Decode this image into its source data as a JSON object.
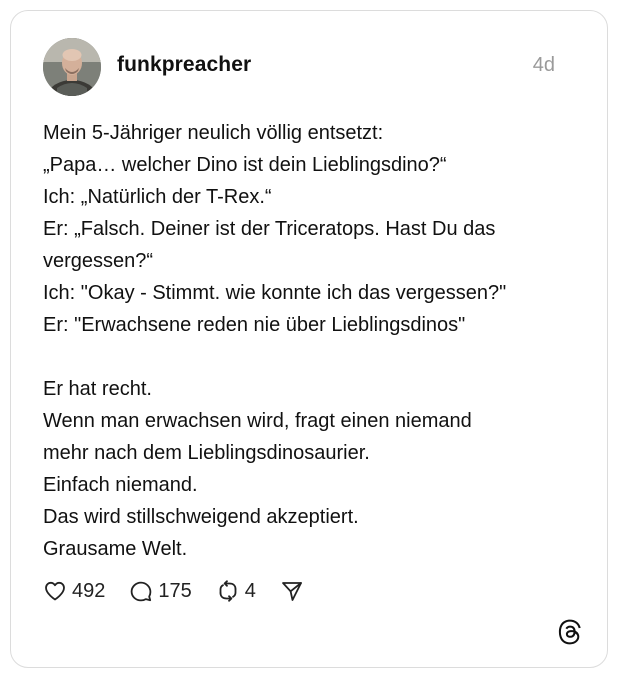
{
  "post": {
    "username": "funkpreacher",
    "time": "4d",
    "lines": [
      "Mein 5-Jähriger neulich völlig entsetzt:",
      "„Papa… welcher Dino ist dein Lieblingsdino?“",
      "Ich: „Natürlich der T-Rex.“",
      "Er: „Falsch. Deiner ist der Triceratops. Hast Du das",
      "vergessen?“",
      "Ich: \"Okay - Stimmt. wie konnte ich das vergessen?\"",
      "Er: \"Erwachsene reden nie über Lieblingsdinos\"",
      "",
      "Er hat recht.",
      "Wenn man erwachsen wird, fragt einen niemand",
      "mehr nach dem Lieblingsdinosaurier.",
      "Einfach niemand.",
      "Das wird stillschweigend akzeptiert.",
      "Grausame Welt."
    ]
  },
  "actions": {
    "likes": "492",
    "comments": "175",
    "reposts": "4"
  },
  "icons": {
    "like": "heart-icon",
    "comment": "comment-bubble-icon",
    "repost": "repost-icon",
    "share": "send-icon",
    "brand": "threads-logo-icon"
  },
  "colors": {
    "text": "#111111",
    "muted": "#9a9a9a",
    "border": "#dcdcdc"
  }
}
